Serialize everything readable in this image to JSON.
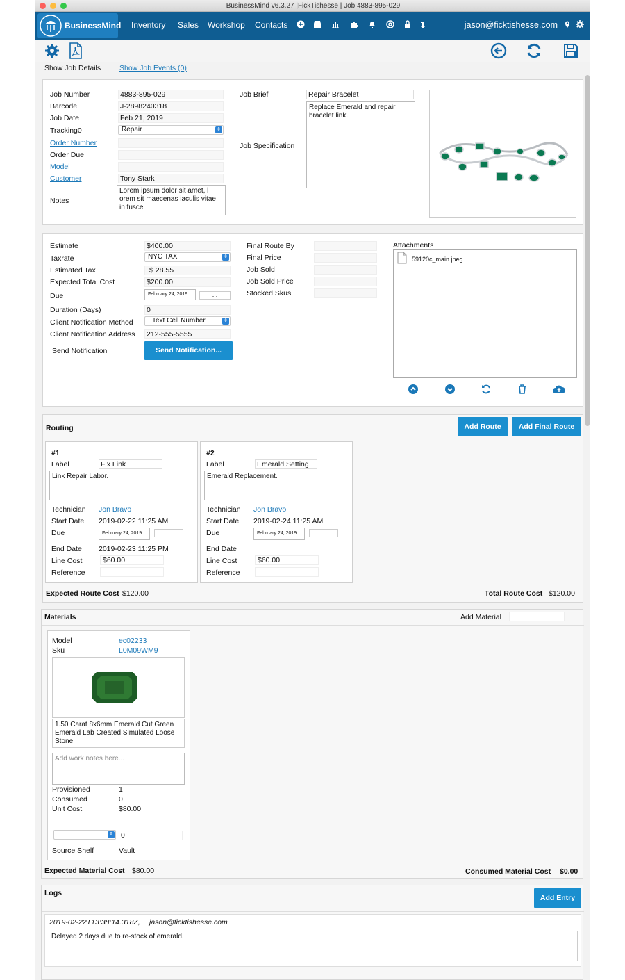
{
  "window": {
    "title": "BusinessMind v6.3.27 |FickTishesse |  Job 4883-895-029"
  },
  "nav": {
    "brand": "BusinessMind",
    "links": [
      "Inventory",
      "Sales",
      "Workshop",
      "Contacts"
    ],
    "user": "jason@ficktishesse.com"
  },
  "tabs": {
    "details": "Show Job Details",
    "events": "Show Job Events (0)"
  },
  "job": {
    "number_label": "Job Number",
    "number": "4883-895-029",
    "barcode_label": "Barcode",
    "barcode": "J-2898240318",
    "date_label": "Job Date",
    "date": "Feb 21, 2019",
    "tracking_label": "Tracking0",
    "tracking": "Repair",
    "order_number_label": "Order Number",
    "order_due_label": "Order Due",
    "model_label": "Model",
    "customer_label": "Customer",
    "customer": "Tony Stark",
    "notes_label": "Notes",
    "notes": "Lorem ipsum dolor sit amet, l orem sit maecenas iaculis vitae in fusce",
    "brief_label": "Job Brief",
    "brief": "Repair Bracelet",
    "spec_label": "Job Specification",
    "spec": "Replace Emerald and repair bracelet link."
  },
  "estimate": {
    "estimate_label": "Estimate",
    "estimate": "$400.00",
    "taxrate_label": "Taxrate",
    "taxrate": "NYC TAX",
    "tax_label": "Estimated Tax",
    "tax": "$ 28.55",
    "total_label": "Expected Total Cost",
    "total": "$200.00",
    "due_label": "Due",
    "due": "February 24, 2019",
    "dots": "...",
    "duration_label": "Duration (Days)",
    "duration": "0",
    "notify_method_label": "Client Notification Method",
    "notify_method": "Text Cell Number",
    "notify_addr_label": "Client Notification Address",
    "notify_addr": "212-555-5555",
    "send_label": "Send Notification",
    "send_button": "Send Notification...",
    "final_route_by_label": "Final Route By",
    "final_price_label": "Final Price",
    "job_sold_label": "Job Sold",
    "job_sold_price_label": "Job Sold Price",
    "stocked_skus_label": "Stocked Skus",
    "attachments_label": "Attachments",
    "attachment_file": "59120c_main.jpeg"
  },
  "routing": {
    "title": "Routing",
    "add_route": "Add Route",
    "add_final_route": "Add Final Route",
    "label_label": "Label",
    "technician_label": "Technician",
    "start_label": "Start Date",
    "due_label": "Due",
    "end_label": "End Date",
    "cost_label": "Line Cost",
    "reference_label": "Reference",
    "routes": [
      {
        "num": "#1",
        "label": "Fix Link",
        "notes": "Link Repair Labor.",
        "technician": "Jon Bravo",
        "start": "2019-02-22 11:25 AM",
        "due": "February 24, 2019",
        "dots": "...",
        "end": "2019-02-23 11:25 PM",
        "cost": "$60.00"
      },
      {
        "num": "#2",
        "label": "Emerald Setting",
        "notes": "Emerald Replacement.",
        "technician": "Jon Bravo",
        "start": "2019-02-24 11:25 AM",
        "due": "February 24, 2019",
        "dots": "...",
        "end": "",
        "cost": "$60.00"
      }
    ],
    "expected_label": "Expected Route Cost",
    "expected": "$120.00",
    "total_label": "Total Route Cost",
    "total": "$120.00"
  },
  "materials": {
    "title": "Materials",
    "add_material": "Add Material",
    "model_label": "Model",
    "model": "ec02233",
    "sku_label": "Sku",
    "sku": "L0M09WM9",
    "description": "1.50 Carat 8x6mm Emerald Cut Green Emerald Lab Created Simulated Loose Stone",
    "notes_placeholder": "Add work notes here...",
    "provisioned_label": "Provisioned",
    "provisioned": "1",
    "consumed_label": "Consumed",
    "consumed": "0",
    "unit_cost_label": "Unit Cost",
    "unit_cost": "$80.00",
    "qty": "0",
    "shelf_label": "Source Shelf",
    "shelf": "Vault",
    "expected_label": "Expected Material Cost",
    "expected": "$80.00",
    "consumed_cost_label": "Consumed Material Cost",
    "consumed_cost": "$0.00"
  },
  "logs": {
    "title": "Logs",
    "add_entry": "Add Entry",
    "entry_meta_time": "2019-02-22T13:38:14.318Z,",
    "entry_meta_user": "jason@ficktishesse.com",
    "entry_text": "Delayed 2 days due to re-stock of emerald."
  },
  "colors": {
    "nav": "#0f5d92",
    "accent": "#1a8fcf",
    "link": "#1a78b8"
  }
}
